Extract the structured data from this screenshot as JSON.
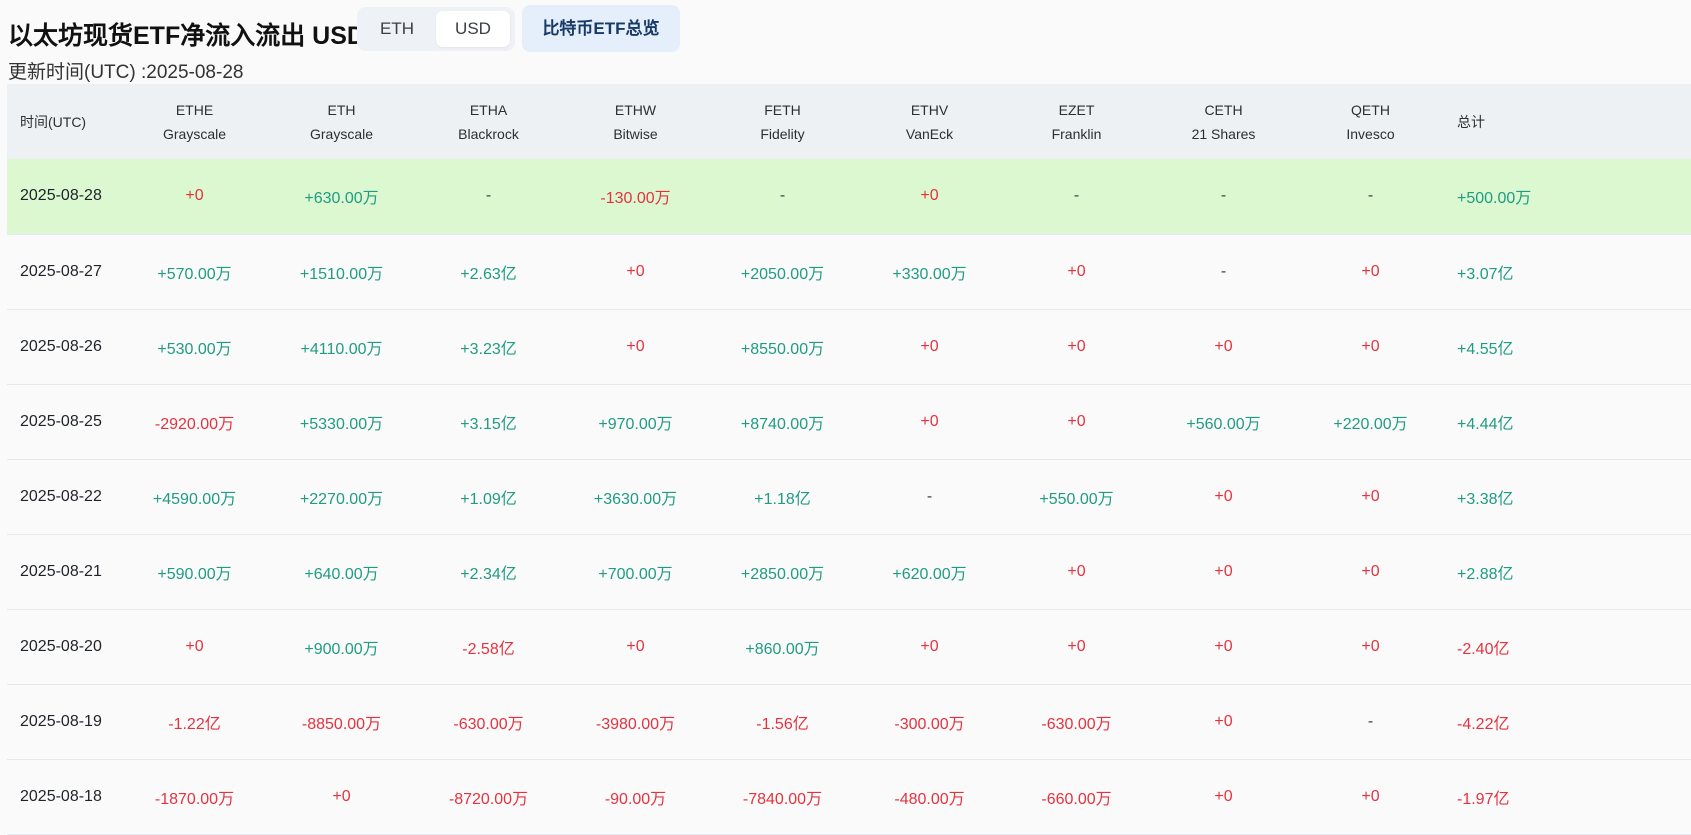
{
  "page": {
    "title": "以太坊现货ETF净流入流出 USD",
    "toggle": {
      "eth_label": "ETH",
      "usd_label": "USD",
      "selected": "USD"
    },
    "btc_button_label": "比特币ETF总览",
    "updated_label": "更新时间(UTC) :2025-08-28"
  },
  "colors": {
    "positive": "#1f9c82",
    "negative": "#e5323f",
    "latest_row_bg": "#dbf8d1",
    "header_bg": "#eef1f4"
  },
  "table": {
    "date_header": "时间(UTC)",
    "total_header": "总计",
    "columns": [
      {
        "ticker": "ETHE",
        "issuer": "Grayscale"
      },
      {
        "ticker": "ETH",
        "issuer": "Grayscale"
      },
      {
        "ticker": "ETHA",
        "issuer": "Blackrock"
      },
      {
        "ticker": "ETHW",
        "issuer": "Bitwise"
      },
      {
        "ticker": "FETH",
        "issuer": "Fidelity"
      },
      {
        "ticker": "ETHV",
        "issuer": "VanEck"
      },
      {
        "ticker": "EZET",
        "issuer": "Franklin"
      },
      {
        "ticker": "CETH",
        "issuer": "21 Shares"
      },
      {
        "ticker": "QETH",
        "issuer": "Invesco"
      }
    ],
    "rows": [
      {
        "date": "2025-08-28",
        "values": [
          "+0",
          "+630.00万",
          "-",
          "-130.00万",
          "-",
          "+0",
          "-",
          "-",
          "-"
        ],
        "total": "+500.00万"
      },
      {
        "date": "2025-08-27",
        "values": [
          "+570.00万",
          "+1510.00万",
          "+2.63亿",
          "+0",
          "+2050.00万",
          "+330.00万",
          "+0",
          "-",
          "+0"
        ],
        "total": "+3.07亿"
      },
      {
        "date": "2025-08-26",
        "values": [
          "+530.00万",
          "+4110.00万",
          "+3.23亿",
          "+0",
          "+8550.00万",
          "+0",
          "+0",
          "+0",
          "+0"
        ],
        "total": "+4.55亿"
      },
      {
        "date": "2025-08-25",
        "values": [
          "-2920.00万",
          "+5330.00万",
          "+3.15亿",
          "+970.00万",
          "+8740.00万",
          "+0",
          "+0",
          "+560.00万",
          "+220.00万"
        ],
        "total": "+4.44亿"
      },
      {
        "date": "2025-08-22",
        "values": [
          "+4590.00万",
          "+2270.00万",
          "+1.09亿",
          "+3630.00万",
          "+1.18亿",
          "-",
          "+550.00万",
          "+0",
          "+0"
        ],
        "total": "+3.38亿"
      },
      {
        "date": "2025-08-21",
        "values": [
          "+590.00万",
          "+640.00万",
          "+2.34亿",
          "+700.00万",
          "+2850.00万",
          "+620.00万",
          "+0",
          "+0",
          "+0"
        ],
        "total": "+2.88亿"
      },
      {
        "date": "2025-08-20",
        "values": [
          "+0",
          "+900.00万",
          "-2.58亿",
          "+0",
          "+860.00万",
          "+0",
          "+0",
          "+0",
          "+0"
        ],
        "total": "-2.40亿"
      },
      {
        "date": "2025-08-19",
        "values": [
          "-1.22亿",
          "-8850.00万",
          "-630.00万",
          "-3980.00万",
          "-1.56亿",
          "-300.00万",
          "-630.00万",
          "+0",
          "-"
        ],
        "total": "-4.22亿"
      },
      {
        "date": "2025-08-18",
        "values": [
          "-1870.00万",
          "+0",
          "-8720.00万",
          "-90.00万",
          "-7840.00万",
          "-480.00万",
          "-660.00万",
          "+0",
          "+0"
        ],
        "total": "-1.97亿"
      }
    ]
  }
}
